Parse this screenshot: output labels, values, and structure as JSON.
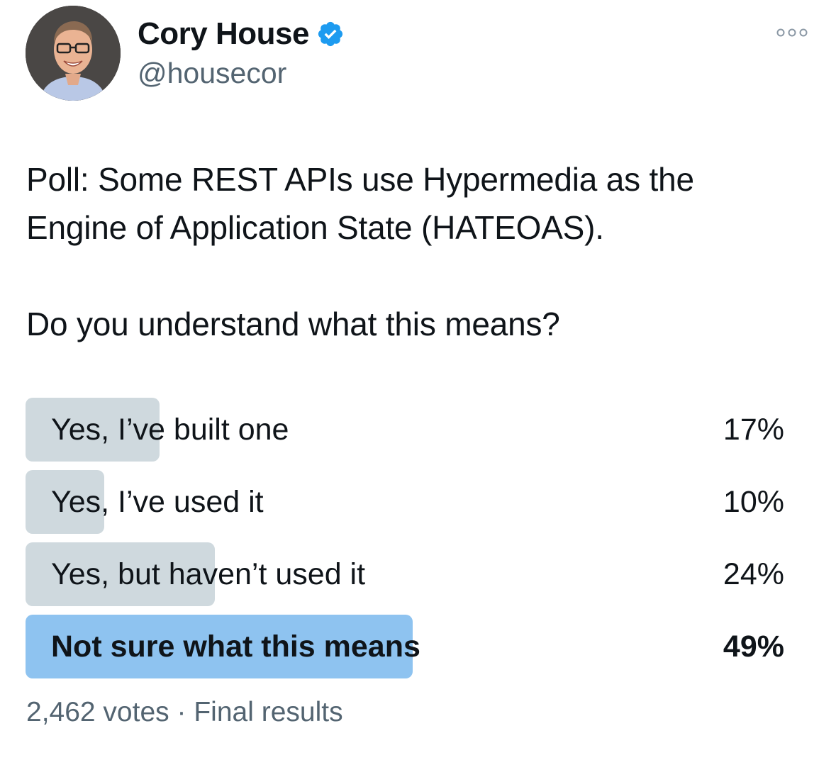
{
  "author": {
    "display_name": "Cory House",
    "handle": "@housecor",
    "verified": true,
    "avatar": "profile-photo"
  },
  "more_icon": "more-horizontal-icon",
  "tweet": {
    "text": "Poll: Some REST APIs use Hypermedia as the\nEngine of Application State (HATEOAS).\n\nDo you understand what this means?"
  },
  "poll": {
    "options": [
      {
        "label": "Yes, I’ve built one",
        "percent": "17%",
        "value": 17,
        "winner": false
      },
      {
        "label": "Yes, I’ve used it",
        "percent": "10%",
        "value": 10,
        "winner": false
      },
      {
        "label": "Yes, but haven’t used it",
        "percent": "24%",
        "value": 24,
        "winner": false
      },
      {
        "label": "Not sure what this means",
        "percent": "49%",
        "value": 49,
        "winner": true
      }
    ],
    "votes": "2,462 votes",
    "separator": "·",
    "status": "Final results"
  },
  "colors": {
    "bar": "#cfd9de",
    "winner_bar": "#8ec3f0",
    "verified": "#1d9bf0",
    "muted_text": "#536471"
  }
}
